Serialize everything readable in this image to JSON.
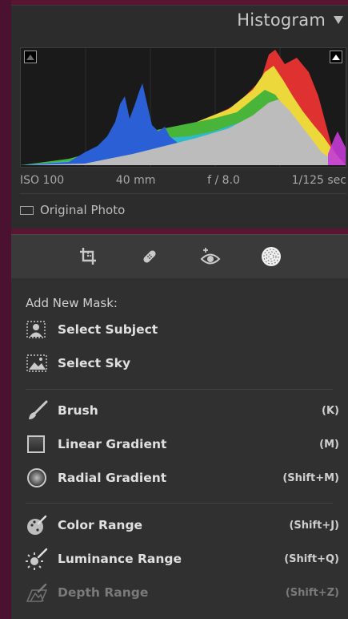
{
  "histogram": {
    "title": "Histogram",
    "exif": {
      "iso": "ISO 100",
      "focal_length": "40 mm",
      "aperture": "f / 8.0",
      "shutter": "1/125 sec"
    },
    "original_photo_label": "Original Photo"
  },
  "tools": [
    {
      "name": "crop-tool-icon"
    },
    {
      "name": "healing-tool-icon"
    },
    {
      "name": "red-eye-tool-icon"
    },
    {
      "name": "masking-tool-icon"
    }
  ],
  "masks": {
    "heading": "Add New Mask:",
    "select_subject": "Select Subject",
    "select_sky": "Select Sky",
    "brush": {
      "label": "Brush",
      "shortcut": "(K)"
    },
    "linear_gradient": {
      "label": "Linear Gradient",
      "shortcut": "(M)"
    },
    "radial_gradient": {
      "label": "Radial Gradient",
      "shortcut": "(Shift+M)"
    },
    "color_range": {
      "label": "Color Range",
      "shortcut": "(Shift+J)"
    },
    "luminance_range": {
      "label": "Luminance Range",
      "shortcut": "(Shift+Q)"
    },
    "depth_range": {
      "label": "Depth Range",
      "shortcut": "(Shift+Z)"
    }
  },
  "colors": {
    "panel_bg": "#303030",
    "accent_frame": "#5a1533"
  }
}
